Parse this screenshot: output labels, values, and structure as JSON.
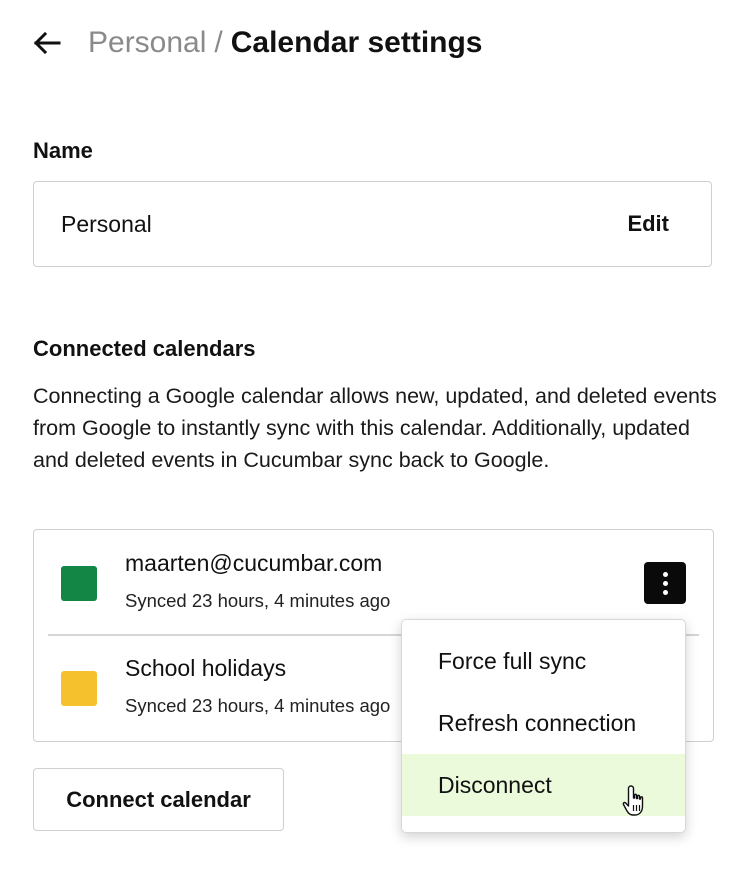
{
  "header": {
    "breadcrumb_parent": "Personal",
    "breadcrumb_separator": "/",
    "title": "Calendar settings"
  },
  "name_section": {
    "label": "Name",
    "value": "Personal",
    "edit_label": "Edit"
  },
  "connected_section": {
    "label": "Connected calendars",
    "description": "Connecting a Google calendar allows new, updated, and deleted events from Google to instantly sync with this calendar. Additionally, updated and deleted events in Cucumbar sync back to Google.",
    "calendars": [
      {
        "name": "maarten@cucumbar.com",
        "sync_status": "Synced 23 hours, 4 minutes ago",
        "color": "#138545"
      },
      {
        "name": "School holidays",
        "sync_status": "Synced 23 hours, 4 minutes ago",
        "color": "#f5c22d"
      }
    ],
    "connect_button_label": "Connect calendar"
  },
  "context_menu": {
    "items": [
      "Force full sync",
      "Refresh connection",
      "Disconnect"
    ],
    "hovered_item": "Disconnect"
  },
  "colors": {
    "hover_background": "#eafadb",
    "kebab_background": "#0a0a0a",
    "muted_text": "#8a8a8a"
  }
}
